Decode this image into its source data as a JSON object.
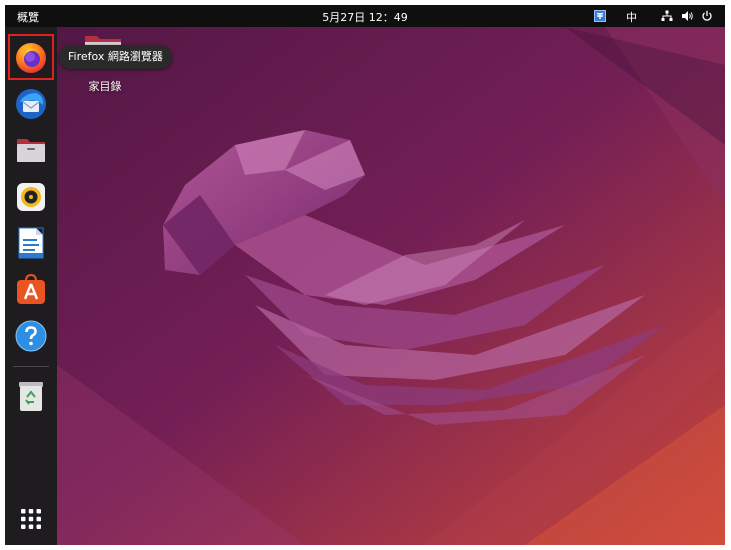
{
  "topbar": {
    "activities_label": "概覽",
    "clock": "5月27日  12：49",
    "input_method": "中",
    "icons": [
      "input-method-icon",
      "network-icon",
      "volume-icon",
      "power-icon"
    ]
  },
  "dock": {
    "items": [
      {
        "name": "firefox",
        "icon": "firefox-icon"
      },
      {
        "name": "thunderbird",
        "icon": "thunderbird-icon"
      },
      {
        "name": "files",
        "icon": "files-icon"
      },
      {
        "name": "rhythmbox",
        "icon": "rhythmbox-icon"
      },
      {
        "name": "libreoffice-writer",
        "icon": "writer-icon"
      },
      {
        "name": "app-center",
        "icon": "app-center-icon"
      },
      {
        "name": "help",
        "icon": "help-icon"
      },
      {
        "name": "trash",
        "icon": "trash-icon"
      },
      {
        "name": "show-applications",
        "icon": "grid-icon"
      }
    ],
    "highlight_color": "#e0231c"
  },
  "tooltip": {
    "text": "Firefox 網路瀏覽器"
  },
  "desktop": {
    "home_label": "家目錄"
  },
  "colors": {
    "topbar": "#0f0f0f",
    "dock": "#1e1c1f",
    "wallpaper_primary": "#6e1e55",
    "wallpaper_accent": "#c8463a"
  }
}
